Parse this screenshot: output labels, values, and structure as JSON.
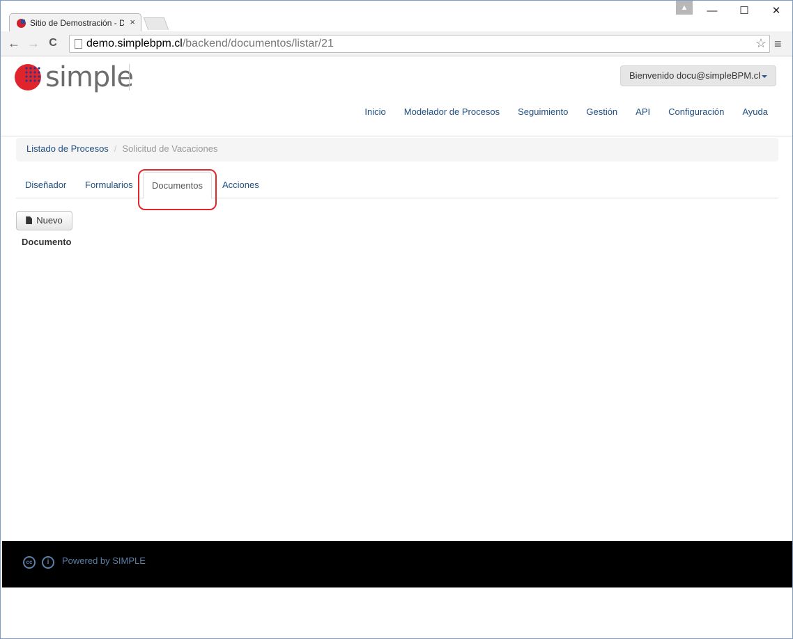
{
  "browser": {
    "tab_title": "Sitio de Demostración - D",
    "tab_close": "×",
    "url_host": "demo.simplebpm.cl",
    "url_path": "/backend/documentos/listar/21",
    "back": "←",
    "forward": "→",
    "reload": "C",
    "star": "☆",
    "menu": "≡",
    "minimize": "—",
    "maximize": "☐",
    "close": "✕",
    "profile": "▲"
  },
  "header": {
    "logo_text": "simple",
    "user_menu_label": "Bienvenido docu@simpleBPM.cl",
    "nav": [
      "Inicio",
      "Modelador de Procesos",
      "Seguimiento",
      "Gestión",
      "API",
      "Configuración",
      "Ayuda"
    ]
  },
  "breadcrumb": {
    "link": "Listado de Procesos",
    "separator": "/",
    "current": "Solicitud de Vacaciones"
  },
  "tabs": [
    "Diseñador",
    "Formularios",
    "Documentos",
    "Acciones"
  ],
  "main": {
    "new_button_label": "Nuevo",
    "column_header": "Documento"
  },
  "footer": {
    "cc_label": "cc",
    "by_label": "i",
    "powered_by": "Powered by SIMPLE"
  }
}
